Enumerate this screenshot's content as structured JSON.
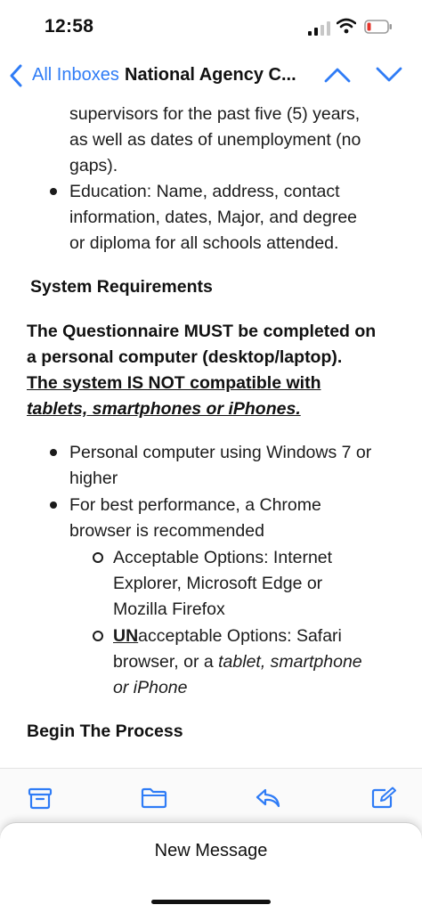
{
  "status_bar": {
    "time": "12:58"
  },
  "nav": {
    "back_label": "All Inboxes",
    "title": "National Agency C..."
  },
  "email": {
    "prev_bullet_tail": [
      "supervisors for the past five (5) years,",
      "as well as dates of unemployment (no",
      "gaps)."
    ],
    "education_bullet": [
      "Education:  Name, address, contact",
      "information, dates, Major, and degree",
      "or diploma for all schools attended."
    ],
    "system_heading": "System Requirements",
    "warning": {
      "line1": "The Questionnaire MUST be completed on",
      "line2": "a personal computer (desktop/laptop).",
      "line3": "The system IS NOT compatible with",
      "line4": "tablets, smartphones or iPhones."
    },
    "req_bullets": [
      [
        "Personal computer using Windows 7 or",
        "higher"
      ],
      [
        "For best performance, a Chrome",
        "browser is recommended"
      ]
    ],
    "sub_bullets": {
      "acceptable": [
        "Acceptable Options: Internet",
        "Explorer, Microsoft Edge or",
        "Mozilla Firefox"
      ],
      "unacceptable": {
        "un_prefix": "UN",
        "line1_rest": "acceptable Options: Safari",
        "line2_plain": "browser, or a ",
        "line2_italic": "tablet, smartphone",
        "line3_italic": "or iPhone"
      }
    },
    "begin_heading": "Begin The Process"
  },
  "toolbar": {
    "icons": [
      "archive-icon",
      "folder-icon",
      "reply-icon",
      "compose-icon"
    ],
    "accent_color": "#2f7cf6"
  },
  "sheet": {
    "label": "New Message"
  }
}
